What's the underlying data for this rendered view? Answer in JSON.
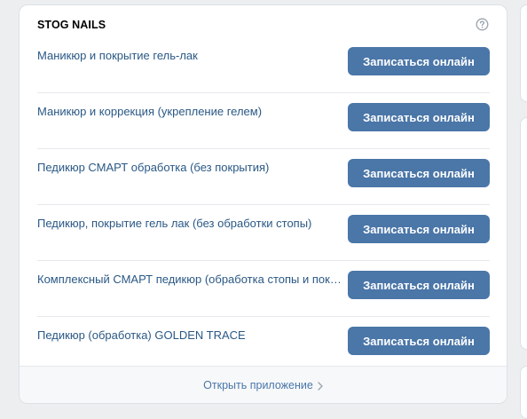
{
  "widget": {
    "title": "STOG NAILS",
    "help_icon": "question-circle-icon"
  },
  "services": [
    {
      "name": "Маникюр и покрытие гель-лак",
      "button_label": "Записаться онлайн"
    },
    {
      "name": "Маникюр и коррекция (укрепление гелем)",
      "button_label": "Записаться онлайн"
    },
    {
      "name": "Педикюр СМАРТ обработка (без покрытия)",
      "button_label": "Записаться онлайн"
    },
    {
      "name": "Педикюр, покрытие гель лак (без обработки стопы)",
      "button_label": "Записаться онлайн"
    },
    {
      "name": "Комплексный СМАРТ педикюр (обработка стопы и покр…",
      "button_label": "Записаться онлайн"
    },
    {
      "name": "Педикюр (обработка) GOLDEN TRACE",
      "button_label": "Записаться онлайн"
    }
  ],
  "footer": {
    "open_app_label": "Открыть приложение",
    "chevron_icon": "chevron-right-icon"
  },
  "colors": {
    "accent": "#4a76a8",
    "link": "#2a5885",
    "background": "#edeef0"
  }
}
